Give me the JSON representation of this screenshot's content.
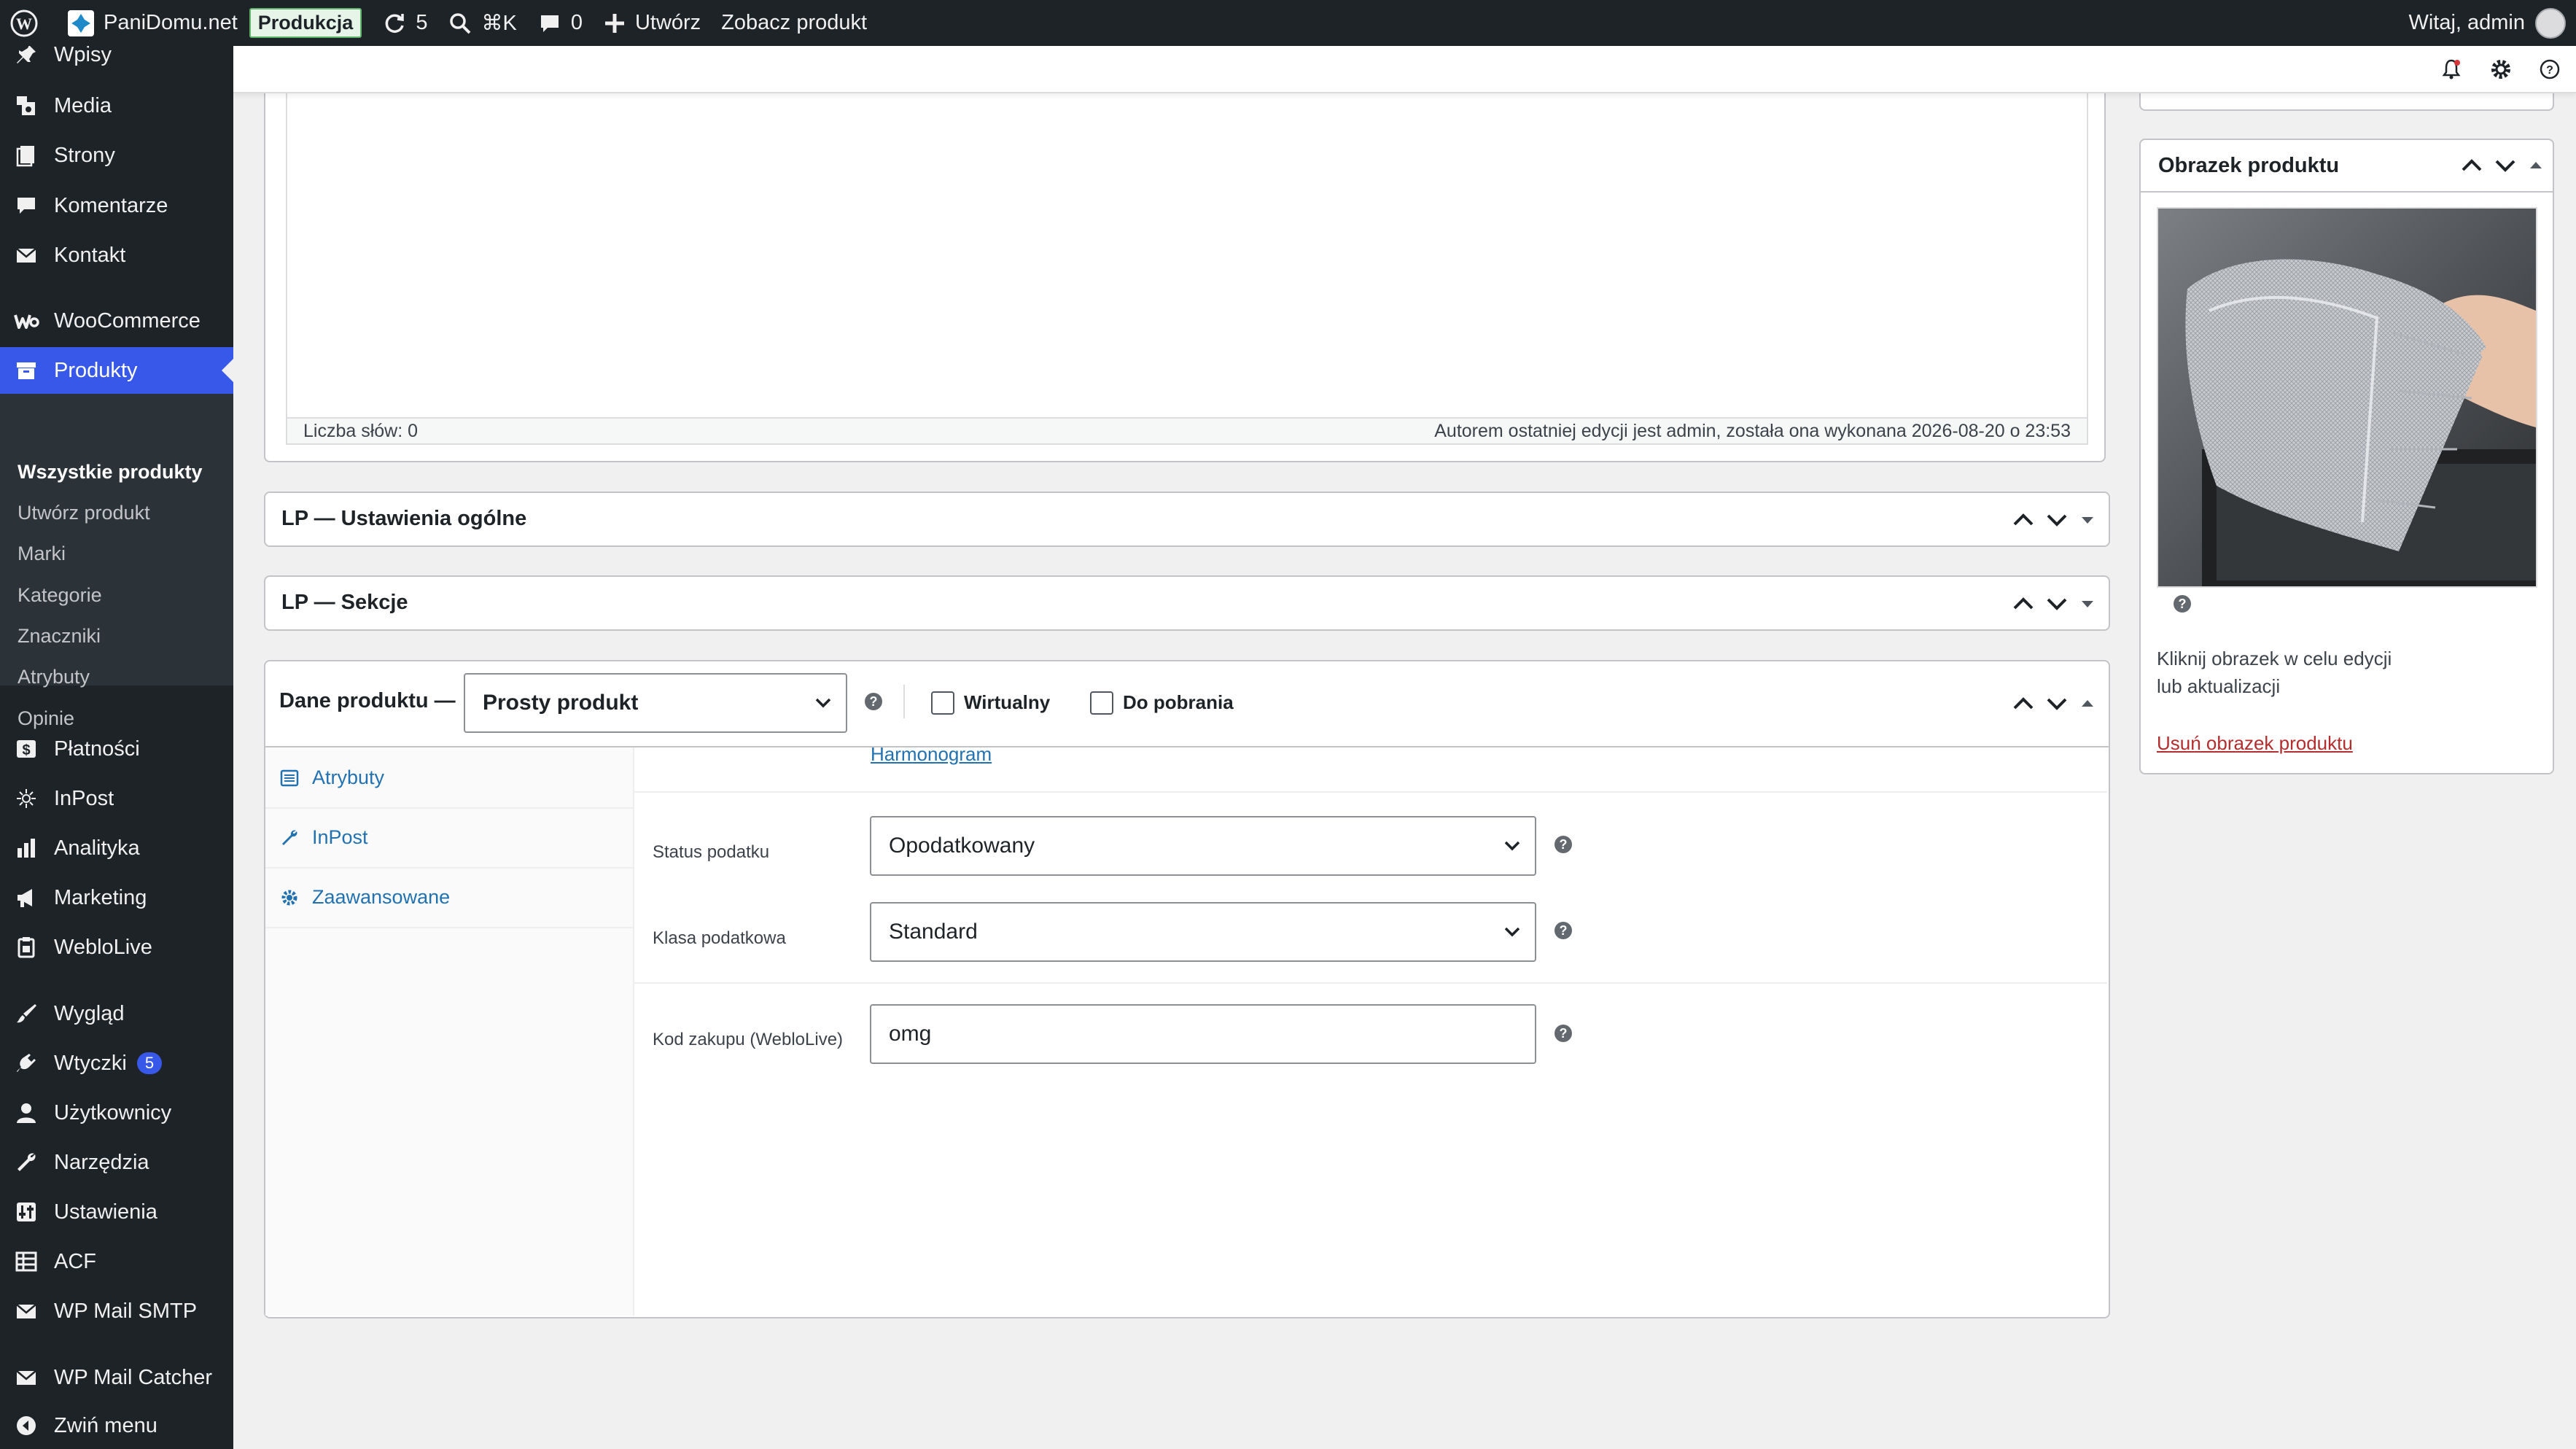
{
  "admin_bar": {
    "site_name": "PaniDomu.net",
    "environment": "Produkcja",
    "updates_count": "5",
    "search_shortcut": "⌘K",
    "comments_count": "0",
    "create_label": "Utwórz",
    "view_product_label": "Zobacz produkt",
    "greeting": "Witaj, admin"
  },
  "sidebar": {
    "items": {
      "wpisy": "Wpisy",
      "media": "Media",
      "strony": "Strony",
      "komentarze": "Komentarze",
      "kontakt": "Kontakt",
      "woocommerce": "WooCommerce",
      "produkty": "Produkty",
      "platnosci": "Płatności",
      "inpost": "InPost",
      "analityka": "Analityka",
      "marketing": "Marketing",
      "weblolive": "WebloLive",
      "wyglad": "Wygląd",
      "wtyczki": "Wtyczki",
      "wtyczki_badge": "5",
      "uzytkownicy": "Użytkownicy",
      "narzedzia": "Narzędzia",
      "ustawienia": "Ustawienia",
      "acf": "ACF",
      "wp_mail_smtp": "WP Mail SMTP",
      "wp_mail_catcher": "WP Mail Catcher",
      "collapse": "Zwiń menu"
    },
    "submenu": {
      "all_products": "Wszystkie produkty",
      "create_product": "Utwórz produkt",
      "brands": "Marki",
      "categories": "Kategorie",
      "tags": "Znaczniki",
      "attributes": "Atrybuty",
      "reviews": "Opinie"
    }
  },
  "editor": {
    "word_count": "Liczba słów: 0",
    "last_edit": "Autorem ostatniej edycji jest admin, została ona wykonana 2026-08-20 o 23:53"
  },
  "metaboxes": {
    "lp_general": "LP — Ustawienia ogólne",
    "lp_sections": "LP — Sekcje"
  },
  "product_data": {
    "title": "Dane produktu —",
    "type_value": "Prosty produkt",
    "virtual_label": "Wirtualny",
    "downloadable_label": "Do pobrania",
    "tabs": {
      "attributes": "Atrybuty",
      "inpost": "InPost",
      "advanced": "Zaawansowane"
    },
    "schedule_link": "Harmonogram",
    "tax_status_label": "Status podatku",
    "tax_status_value": "Opodatkowany",
    "tax_class_label": "Klasa podatkowa",
    "tax_class_value": "Standard",
    "purchase_code_label": "Kod zakupu (WebloLive)",
    "purchase_code_value": "omg"
  },
  "product_image": {
    "title": "Obrazek produktu",
    "hint_line1": "Kliknij obrazek w celu edycji",
    "hint_line2": "lub aktualizacji",
    "remove_link": "Usuń obrazek produktu"
  },
  "colors": {
    "admin_dark": "#1d2327",
    "accent": "#3858e9",
    "link": "#2271b1",
    "danger_link": "#b32d2e"
  }
}
